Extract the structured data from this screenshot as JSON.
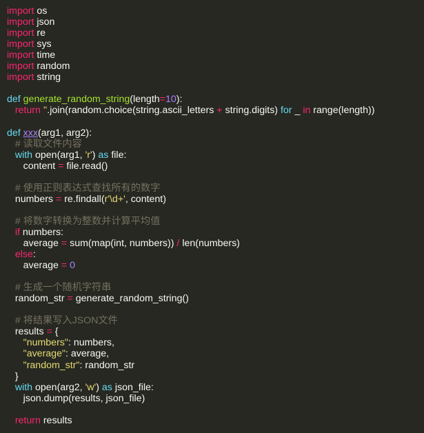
{
  "code_lines": [
    [
      [
        "kw",
        "import"
      ],
      [
        "plain",
        " os"
      ]
    ],
    [
      [
        "kw",
        "import"
      ],
      [
        "plain",
        " json"
      ]
    ],
    [
      [
        "kw",
        "import"
      ],
      [
        "plain",
        " re"
      ]
    ],
    [
      [
        "kw",
        "import"
      ],
      [
        "plain",
        " sys"
      ]
    ],
    [
      [
        "kw",
        "import"
      ],
      [
        "plain",
        " time"
      ]
    ],
    [
      [
        "kw",
        "import"
      ],
      [
        "plain",
        " random"
      ]
    ],
    [
      [
        "kw",
        "import"
      ],
      [
        "plain",
        " string"
      ]
    ],
    [],
    [
      [
        "blue",
        "def "
      ],
      [
        "fn",
        "generate_random_string"
      ],
      [
        "plain",
        "("
      ],
      [
        "plain",
        "length"
      ],
      [
        "op",
        "="
      ],
      [
        "num",
        "10"
      ],
      [
        "plain",
        "):"
      ]
    ],
    [
      [
        "plain",
        "   "
      ],
      [
        "kw",
        "return "
      ],
      [
        "str",
        "''"
      ],
      [
        "plain",
        ".join(random.choice(string.ascii_letters "
      ],
      [
        "op",
        "+"
      ],
      [
        "plain",
        " string.digits) "
      ],
      [
        "blue",
        "for"
      ],
      [
        "plain",
        " _ "
      ],
      [
        "kw",
        "in"
      ],
      [
        "plain",
        " range(length))"
      ]
    ],
    [],
    [
      [
        "blue",
        "def "
      ],
      [
        "mag",
        "xxx"
      ],
      [
        "plain",
        "(arg1, arg2):"
      ]
    ],
    [
      [
        "plain",
        "   "
      ],
      [
        "cmt",
        "# 读取文件内容"
      ]
    ],
    [
      [
        "plain",
        "   "
      ],
      [
        "blue",
        "with"
      ],
      [
        "plain",
        " open(arg1, "
      ],
      [
        "str",
        "'r'"
      ],
      [
        "plain",
        ") "
      ],
      [
        "blue",
        "as"
      ],
      [
        "plain",
        " file:"
      ]
    ],
    [
      [
        "plain",
        "      content "
      ],
      [
        "op",
        "="
      ],
      [
        "plain",
        " file.read()"
      ]
    ],
    [],
    [
      [
        "plain",
        "   "
      ],
      [
        "cmt",
        "# 使用正则表达式查找所有的数字"
      ]
    ],
    [
      [
        "plain",
        "   numbers "
      ],
      [
        "op",
        "="
      ],
      [
        "plain",
        " re.findall("
      ],
      [
        "str",
        "r'\\d+'"
      ],
      [
        "plain",
        ", content)"
      ]
    ],
    [],
    [
      [
        "plain",
        "   "
      ],
      [
        "cmt",
        "# 将数字转换为整数并计算平均值"
      ]
    ],
    [
      [
        "plain",
        "   "
      ],
      [
        "kw",
        "if"
      ],
      [
        "plain",
        " numbers:"
      ]
    ],
    [
      [
        "plain",
        "      average "
      ],
      [
        "op",
        "="
      ],
      [
        "plain",
        " sum(map(int, numbers)) "
      ],
      [
        "op",
        "/"
      ],
      [
        "plain",
        " len(numbers)"
      ]
    ],
    [
      [
        "plain",
        "   "
      ],
      [
        "kw",
        "else"
      ],
      [
        "plain",
        ":"
      ]
    ],
    [
      [
        "plain",
        "      average "
      ],
      [
        "op",
        "="
      ],
      [
        "plain",
        " "
      ],
      [
        "num",
        "0"
      ]
    ],
    [],
    [
      [
        "plain",
        "   "
      ],
      [
        "cmt",
        "# 生成一个随机字符串"
      ]
    ],
    [
      [
        "plain",
        "   random_str "
      ],
      [
        "op",
        "="
      ],
      [
        "plain",
        " generate_random_string()"
      ]
    ],
    [],
    [
      [
        "plain",
        "   "
      ],
      [
        "cmt",
        "# 将结果写入JSON文件"
      ]
    ],
    [
      [
        "plain",
        "   results "
      ],
      [
        "op",
        "="
      ],
      [
        "plain",
        " {"
      ]
    ],
    [
      [
        "plain",
        "      "
      ],
      [
        "str",
        "\"numbers\""
      ],
      [
        "plain",
        ": numbers,"
      ]
    ],
    [
      [
        "plain",
        "      "
      ],
      [
        "str",
        "\"average\""
      ],
      [
        "plain",
        ": average,"
      ]
    ],
    [
      [
        "plain",
        "      "
      ],
      [
        "str",
        "\"random_str\""
      ],
      [
        "plain",
        ": random_str"
      ]
    ],
    [
      [
        "plain",
        "   }"
      ]
    ],
    [
      [
        "plain",
        "   "
      ],
      [
        "blue",
        "with"
      ],
      [
        "plain",
        " open(arg2, "
      ],
      [
        "str",
        "'w'"
      ],
      [
        "plain",
        ") "
      ],
      [
        "blue",
        "as"
      ],
      [
        "plain",
        " json_file:"
      ]
    ],
    [
      [
        "plain",
        "      json.dump(results, json_file)"
      ]
    ],
    [],
    [
      [
        "plain",
        "   "
      ],
      [
        "kw",
        "return"
      ],
      [
        "plain",
        " results"
      ]
    ]
  ],
  "colors": {
    "background": "#272822",
    "foreground": "#f8f8f2",
    "keyword": "#f92672",
    "storage": "#66d9ef",
    "function": "#a6e22e",
    "string": "#e6db74",
    "number": "#ae81ff",
    "comment": "#75715e"
  }
}
